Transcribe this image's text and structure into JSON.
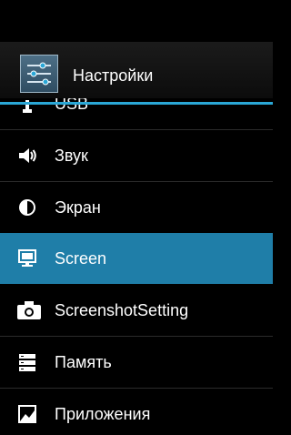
{
  "actionbar": {
    "title": "Настройки",
    "icon": "settings-sliders-icon"
  },
  "list": {
    "items": [
      {
        "label": "USB",
        "icon": "usb-icon"
      },
      {
        "label": "Звук",
        "icon": "speaker-icon"
      },
      {
        "label": "Экран",
        "icon": "brightness-icon"
      },
      {
        "label": "Screen",
        "icon": "monitor-icon",
        "selected": true
      },
      {
        "label": "ScreenshotSetting",
        "icon": "camera-icon"
      },
      {
        "label": "Память",
        "icon": "storage-icon"
      },
      {
        "label": "Приложения",
        "icon": "apps-icon"
      }
    ]
  },
  "colors": {
    "accent": "#2aa7d6",
    "selected_bg": "#1f7ea8",
    "background": "#000000"
  }
}
